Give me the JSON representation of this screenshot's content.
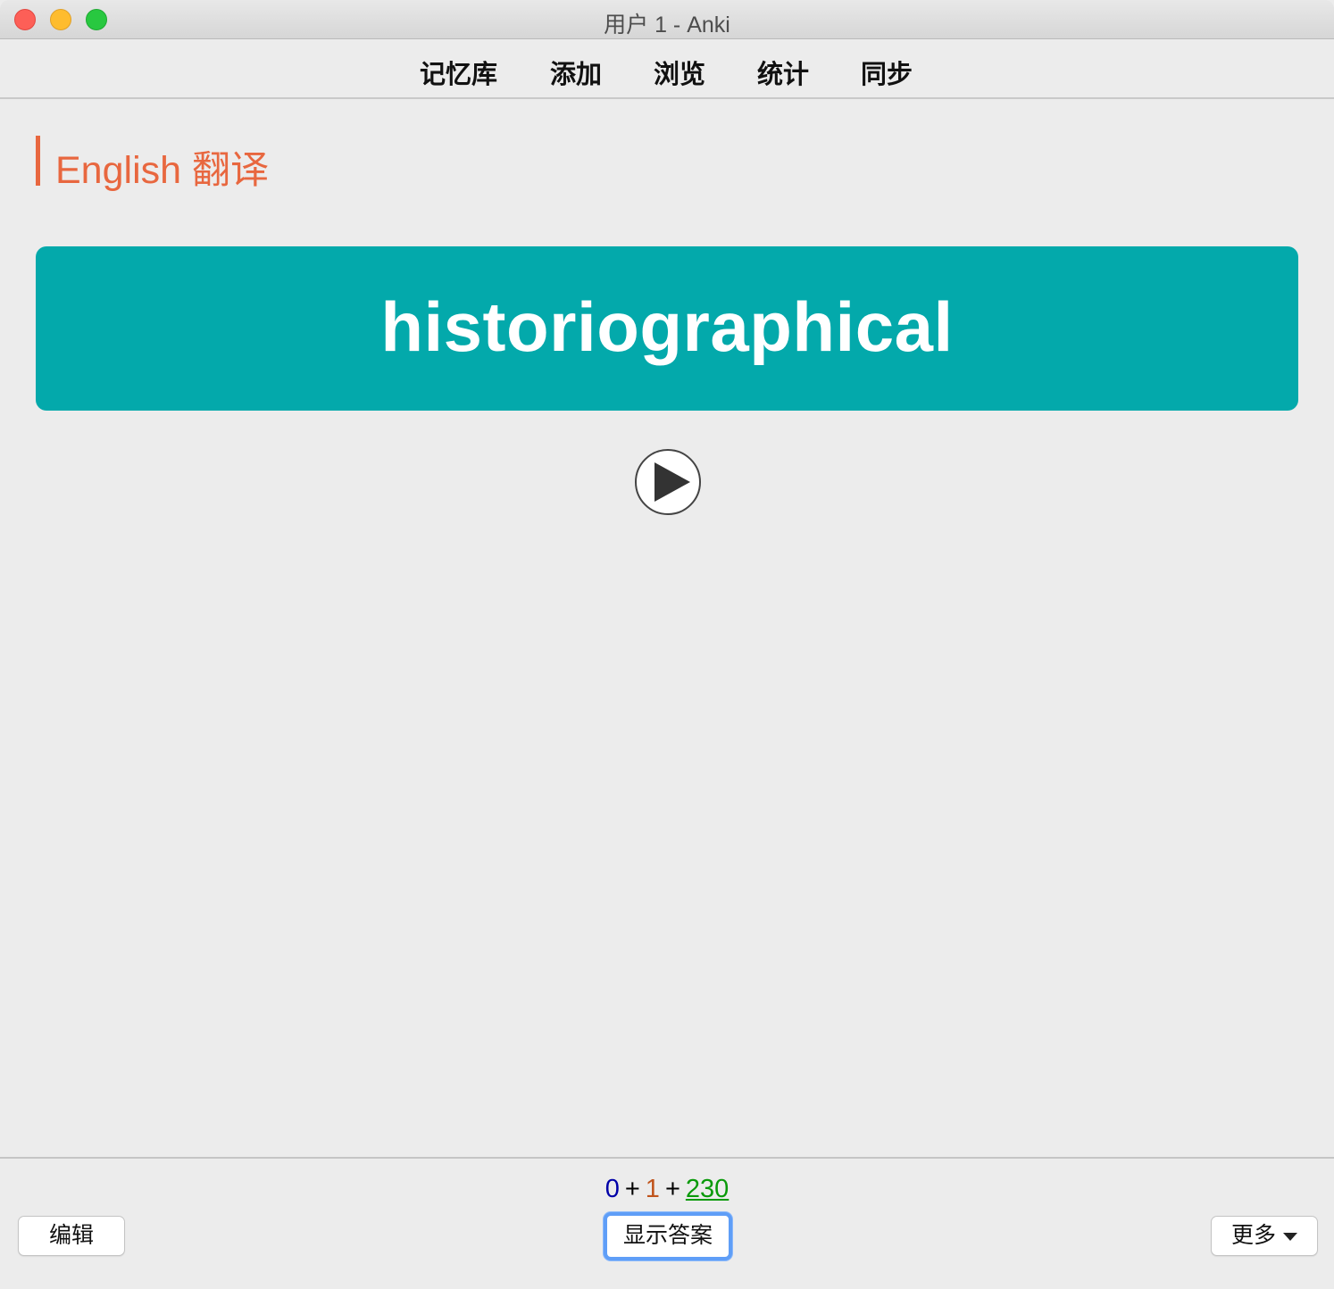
{
  "window": {
    "title": "用户 1 - Anki"
  },
  "toolbar": {
    "items": [
      {
        "label": "记忆库"
      },
      {
        "label": "添加"
      },
      {
        "label": "浏览"
      },
      {
        "label": "统计"
      },
      {
        "label": "同步"
      }
    ]
  },
  "deck": {
    "name": "English 翻译",
    "accent_color": "#e8673f"
  },
  "card": {
    "front": "historiographical",
    "background_color": "#03a9ab",
    "audio_icon": "play-icon"
  },
  "counts": {
    "new": "0",
    "learning": "1",
    "review": "230",
    "separator": "+"
  },
  "buttons": {
    "edit_label": "编辑",
    "show_answer_label": "显示答案",
    "more_label": "更多"
  }
}
